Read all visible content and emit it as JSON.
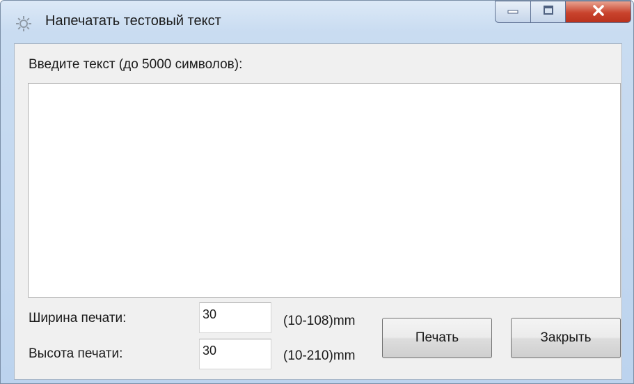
{
  "window": {
    "title": "Напечатать тестовый текст",
    "controls": {
      "minimize_icon": "minimize-icon",
      "maximize_icon": "maximize-icon",
      "close_icon": "close-icon",
      "close_color": "#c9432d"
    },
    "app_icon": "gear-icon"
  },
  "form": {
    "prompt_label": "Введите текст (до 5000 символов):",
    "text_value": "",
    "width": {
      "label": "Ширина печати:",
      "value": "30",
      "range": "(10-108)mm"
    },
    "height": {
      "label": "Высота печати:",
      "value": "30",
      "range": "(10-210)mm"
    },
    "print_button": "Печать",
    "close_button": "Закрыть"
  }
}
